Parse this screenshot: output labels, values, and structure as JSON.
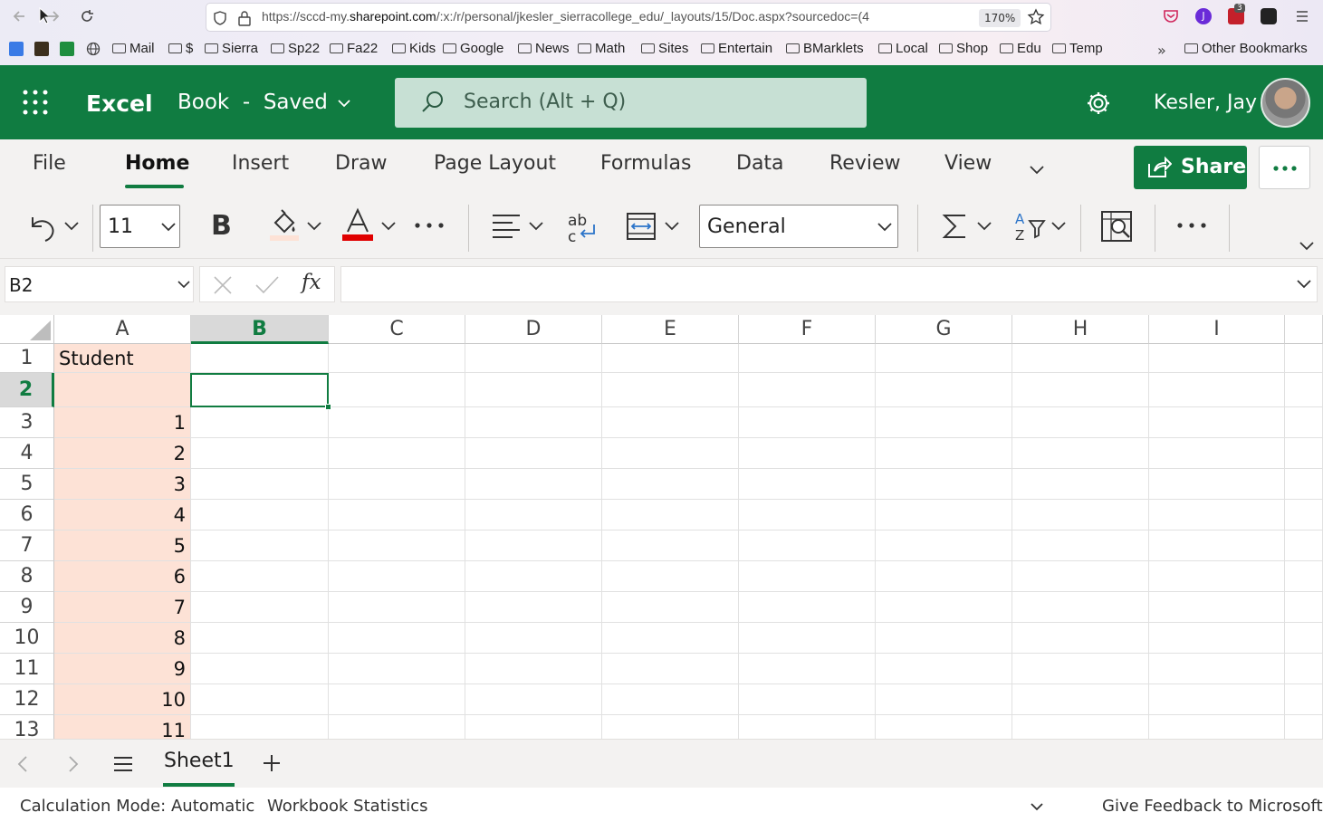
{
  "browser": {
    "url_prefix": "https://sccd-my.",
    "url_domain": "sharepoint.com",
    "url_rest": "/:x:/r/personal/jkesler_sierracollege_edu/_layouts/15/Doc.aspx?sourcedoc=(4",
    "zoom": "170%",
    "extension_badge": "3",
    "extension_letter": "J",
    "bookmarks": [
      "Mail",
      "$",
      "Sierra",
      "Sp22",
      "Fa22",
      "Kids",
      "Google",
      "News",
      "Math",
      "Sites",
      "Entertain",
      "BMarklets",
      "Local",
      "Shop",
      "Edu",
      "Temp"
    ],
    "other_bookmarks": "Other Bookmarks"
  },
  "excel": {
    "app_name": "Excel",
    "doc_title": "Book",
    "doc_sep": "-",
    "doc_status": "Saved",
    "search_placeholder": "Search (Alt + Q)",
    "user_name": "Kesler, Jay"
  },
  "ribbon": {
    "tabs": [
      "File",
      "Home",
      "Insert",
      "Draw",
      "Page Layout",
      "Formulas",
      "Data",
      "Review",
      "View"
    ],
    "active_tab": "Home",
    "share_label": "Share",
    "font_size": "11",
    "number_format": "General"
  },
  "formula_bar": {
    "name_box": "B2",
    "fx": "fx",
    "formula": ""
  },
  "sheet": {
    "columns": [
      "A",
      "B",
      "C",
      "D",
      "E",
      "F",
      "G",
      "H",
      "I"
    ],
    "selected_column": "B",
    "row_numbers": [
      "1",
      "2",
      "3",
      "4",
      "5",
      "6",
      "7",
      "8",
      "9",
      "10",
      "11",
      "12",
      "13"
    ],
    "selected_row": "2",
    "colA": [
      "Student",
      "",
      "1",
      "2",
      "3",
      "4",
      "5",
      "6",
      "7",
      "8",
      "9",
      "10",
      "11"
    ],
    "colA_fill": "#fde2d6",
    "selected_cell": "B2"
  },
  "sheet_tabs": {
    "active": "Sheet1"
  },
  "status_bar": {
    "calc_mode": "Calculation Mode: Automatic",
    "stats": "Workbook Statistics",
    "feedback": "Give Feedback to Microsoft"
  },
  "colors": {
    "excel_green": "#107c41",
    "font_color_bar": "#e00000"
  }
}
